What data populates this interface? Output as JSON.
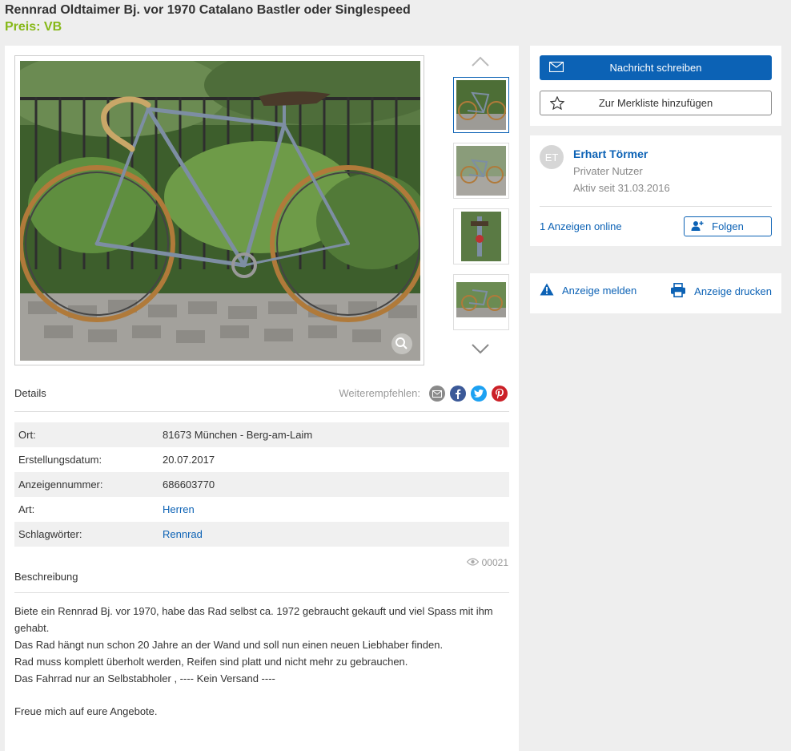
{
  "listing": {
    "title": "Rennrad Oldtaimer Bj. vor 1970 Catalano Bastler oder Singlespeed",
    "price": "Preis: VB"
  },
  "details": {
    "header": "Details",
    "share_label": "Weiterempfehlen:",
    "rows": [
      {
        "key": "Ort:",
        "value": "81673 München - Berg-am-Laim"
      },
      {
        "key": "Erstellungsdatum:",
        "value": "20.07.2017"
      },
      {
        "key": "Anzeigennummer:",
        "value": "686603770"
      },
      {
        "key": "Art:",
        "value": "Herren"
      },
      {
        "key": "Schlagwörter:",
        "value": "Rennrad"
      }
    ]
  },
  "views": "00021",
  "description": {
    "header": "Beschreibung",
    "lines": [
      "Biete ein Rennrad Bj. vor 1970, habe das Rad selbst ca. 1972 gebraucht gekauft und viel Spass mit ihm gehabt.",
      "Das Rad hängt nun schon 20 Jahre an der Wand und soll nun einen neuen Liebhaber finden.",
      "Rad muss komplett überholt werden, Reifen sind platt und nicht mehr zu gebrauchen.",
      "Das Fahrrad nur an Selbstabholer , ---- Kein Versand ----",
      "Freue mich auf eure Angebote."
    ]
  },
  "actions": {
    "message": "Nachricht schreiben",
    "watchlist": "Zur Merkliste hinzufügen"
  },
  "seller": {
    "initials": "ET",
    "name": "Erhart Törmer",
    "type": "Privater Nutzer",
    "since": "Aktiv seit 31.03.2016",
    "ads_online": "1 Anzeigen online",
    "follow": "Folgen"
  },
  "tools": {
    "report": "Anzeige melden",
    "print": "Anzeige drucken"
  },
  "colors": {
    "accent": "#0c62b5",
    "price": "#86b817"
  },
  "icons": [
    "envelope-icon",
    "star-icon",
    "follow-user-icon",
    "warning-icon",
    "printer-icon",
    "eye-icon",
    "email-share-icon",
    "facebook-icon",
    "twitter-icon",
    "pinterest-icon",
    "chevron-up-icon",
    "chevron-down-icon",
    "zoom-icon"
  ]
}
